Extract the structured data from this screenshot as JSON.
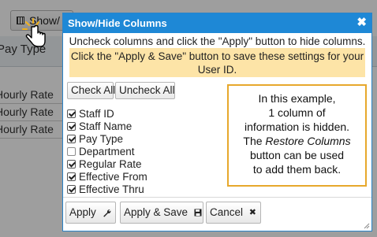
{
  "background": {
    "showhide_button_label": "Show/",
    "header_text": "Pay Type",
    "row_cells": [
      "Hourly Rate",
      "Hourly Rate",
      "Hourly Rate"
    ]
  },
  "dialog": {
    "title": "Show/Hide Columns",
    "close_glyph": "✖",
    "instruction": "Uncheck columns and click the \"Apply\" button to hide columns.",
    "note_line1": "Click the \"Apply & Save\" button to save these settings for your",
    "note_line2": "User ID.",
    "check_all_label": "Check All",
    "uncheck_all_label": "Uncheck All",
    "columns": [
      {
        "label": "Staff ID",
        "checked": true
      },
      {
        "label": "Staff Name",
        "checked": true
      },
      {
        "label": "Pay Type",
        "checked": true
      },
      {
        "label": "Department",
        "checked": false
      },
      {
        "label": "Regular Rate",
        "checked": true
      },
      {
        "label": "Effective From",
        "checked": true
      },
      {
        "label": "Effective Thru",
        "checked": true
      }
    ],
    "callout": {
      "line1": "In this example,",
      "line2": "1 column of",
      "line3": "information is hidden.",
      "line4_prefix": "The ",
      "line4_em": "Restore Columns",
      "line5": "button can be used",
      "line6": "to add them back."
    },
    "apply_label": "Apply",
    "apply_save_label": "Apply & Save",
    "cancel_label": "Cancel",
    "icons": {
      "apply": "wrench-icon",
      "apply_save": "save-icon",
      "cancel": "close-icon"
    }
  },
  "colors": {
    "titlebar": "#1e88d6",
    "note_bg": "#fde4a7",
    "callout_border": "#e7a82c"
  }
}
